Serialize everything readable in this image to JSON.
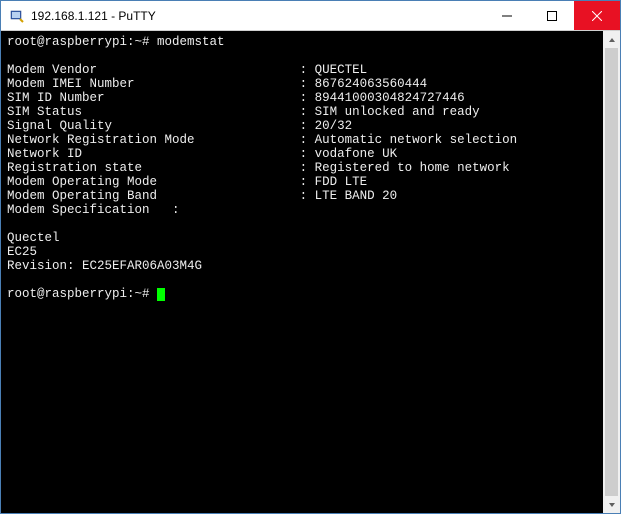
{
  "window": {
    "title": "192.168.1.121 - PuTTY"
  },
  "prompt1": {
    "prefix": "root@raspberrypi:~# ",
    "command": "modemstat"
  },
  "fields": [
    {
      "label": "Modem Vendor",
      "value": "QUECTEL"
    },
    {
      "label": "Modem IMEI Number",
      "value": "867624063560444"
    },
    {
      "label": "SIM ID Number",
      "value": "89441000304824727446"
    },
    {
      "label": "SIM Status",
      "value": "SIM unlocked and ready"
    },
    {
      "label": "Signal Quality",
      "value": "20/32"
    },
    {
      "label": "Network Registration Mode",
      "value": "Automatic network selection"
    },
    {
      "label": "Network ID",
      "value": "vodafone UK"
    },
    {
      "label": "Registration state",
      "value": "Registered to home network"
    },
    {
      "label": "Modem Operating Mode",
      "value": "FDD LTE"
    },
    {
      "label": "Modem Operating Band",
      "value": "LTE BAND 20"
    }
  ],
  "spec_line": "Modem Specification   :",
  "spec_details": {
    "line1": "Quectel",
    "line2": "EC25",
    "line3": "Revision: EC25EFAR06A03M4G"
  },
  "prompt2": {
    "prefix": "root@raspberrypi:~# "
  }
}
